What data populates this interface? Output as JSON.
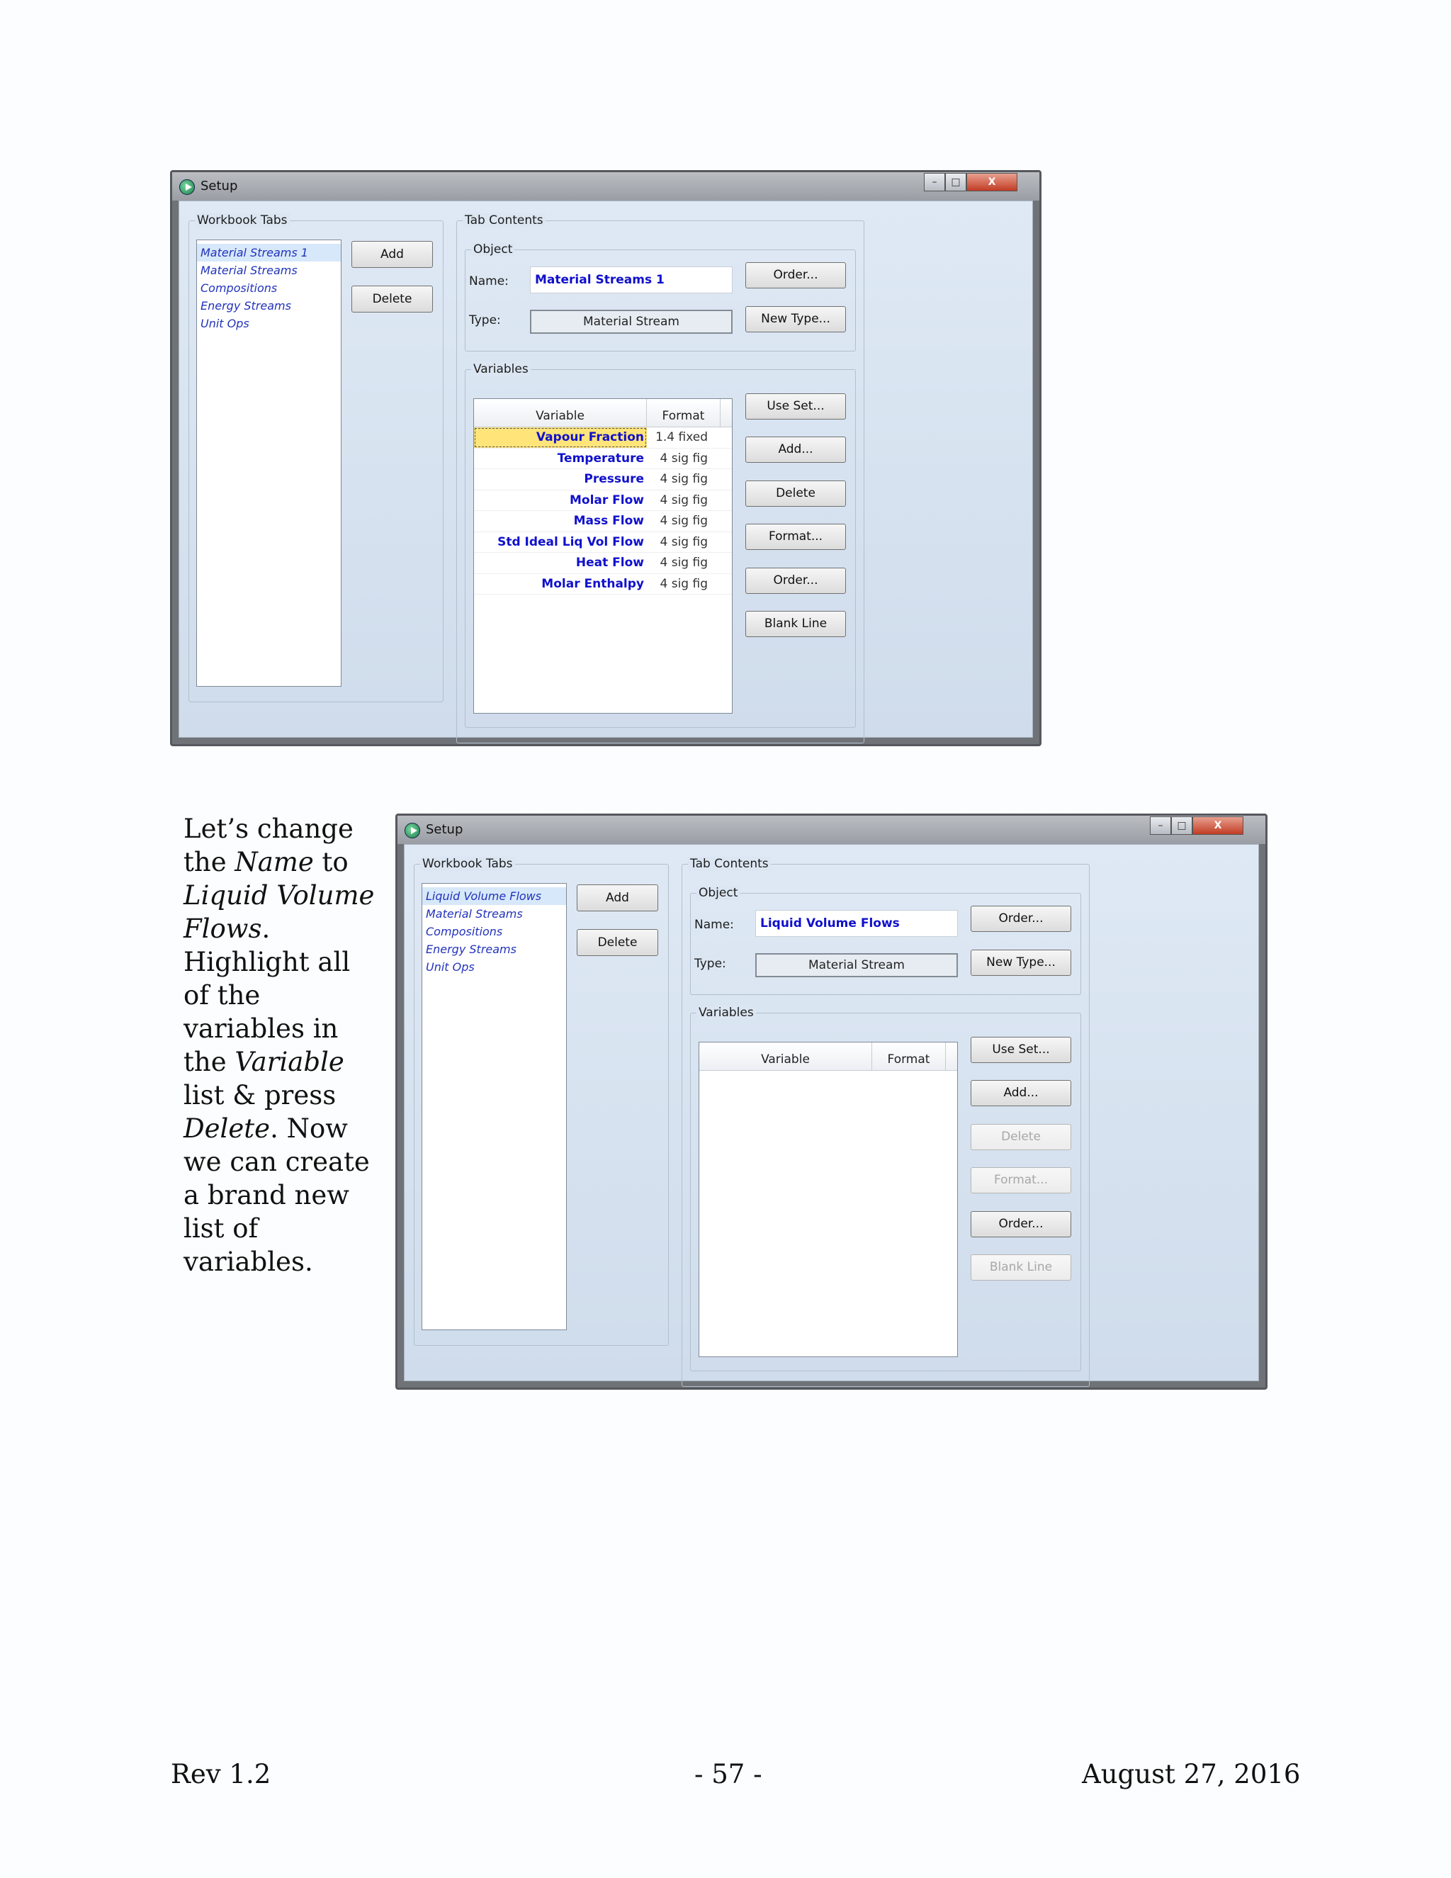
{
  "window1": {
    "title": "Setup",
    "workbook_tabs": {
      "legend": "Workbook Tabs",
      "items": [
        "Material Streams 1",
        "Material Streams",
        "Compositions",
        "Energy Streams",
        "Unit Ops"
      ],
      "add_label": "Add",
      "delete_label": "Delete"
    },
    "tab_contents": {
      "legend": "Tab Contents",
      "object_legend": "Object",
      "name_label": "Name:",
      "name_value": "Material Streams 1",
      "type_label": "Type:",
      "type_value": "Material Stream",
      "order_label": "Order...",
      "new_type_label": "New Type...",
      "variables_legend": "Variables",
      "col_variable": "Variable",
      "col_format": "Format",
      "rows": [
        {
          "variable": "Vapour Fraction",
          "format": "1.4 fixed"
        },
        {
          "variable": "Temperature",
          "format": "4 sig fig"
        },
        {
          "variable": "Pressure",
          "format": "4 sig fig"
        },
        {
          "variable": "Molar Flow",
          "format": "4 sig fig"
        },
        {
          "variable": "Mass Flow",
          "format": "4 sig fig"
        },
        {
          "variable": "Std Ideal Liq Vol Flow",
          "format": "4 sig fig"
        },
        {
          "variable": "Heat Flow",
          "format": "4 sig fig"
        },
        {
          "variable": "Molar Enthalpy",
          "format": "4 sig fig"
        }
      ],
      "buttons": [
        "Use Set...",
        "Add...",
        "Delete",
        "Format...",
        "Order...",
        "Blank Line"
      ]
    }
  },
  "window2": {
    "title": "Setup",
    "workbook_tabs": {
      "legend": "Workbook Tabs",
      "items": [
        "Liquid Volume Flows",
        "Material Streams",
        "Compositions",
        "Energy Streams",
        "Unit Ops"
      ],
      "add_label": "Add",
      "delete_label": "Delete"
    },
    "tab_contents": {
      "legend": "Tab Contents",
      "object_legend": "Object",
      "name_label": "Name:",
      "name_value": "Liquid Volume Flows",
      "type_label": "Type:",
      "type_value": "Material Stream",
      "order_label": "Order...",
      "new_type_label": "New Type...",
      "variables_legend": "Variables",
      "col_variable": "Variable",
      "col_format": "Format",
      "buttons": [
        "Use Set...",
        "Add...",
        "Delete",
        "Format...",
        "Order...",
        "Blank Line"
      ]
    }
  },
  "paragraph": {
    "t1": "Let’s change the ",
    "t2": "Name",
    "t3": " to ",
    "t4": "Liquid Volume Flows",
    "t5": ". Highlight all of the variables in the ",
    "t6": "Variable",
    "t7": " list & press ",
    "t8": "Delete",
    "t9": ". Now we can create a brand new list of variables."
  },
  "footer": {
    "revision": "Rev 1.2",
    "page": "- 57 -",
    "date": "August 27, 2016"
  }
}
